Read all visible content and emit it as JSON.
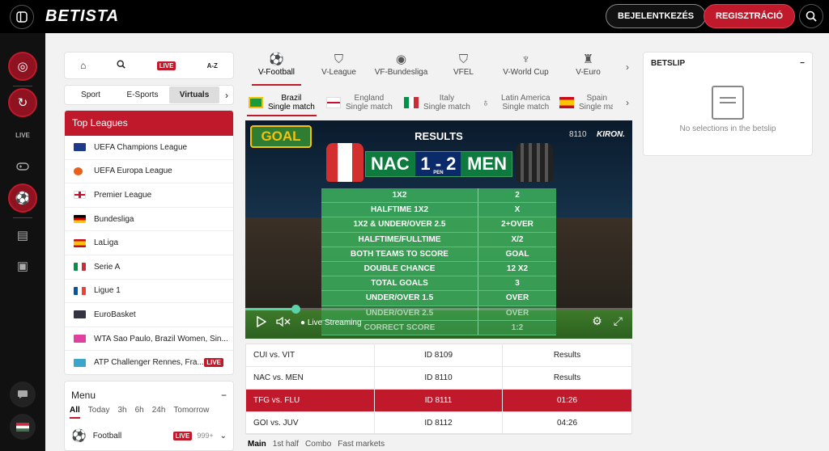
{
  "header": {
    "logo": "BETISTA",
    "login_label": "BEJELENTKEZÉS",
    "register_label": "REGISZTRÁCIÓ"
  },
  "rail": {
    "live_label": "LIVE"
  },
  "quick_tabs": {
    "live": "LIVE",
    "az": "A-Z"
  },
  "sport_tabs": [
    "Sport",
    "E-Sports",
    "Virtuals"
  ],
  "top_leagues": {
    "title": "Top Leagues",
    "items": [
      {
        "name": "UEFA Champions League",
        "live": false
      },
      {
        "name": "UEFA Europa League",
        "live": false
      },
      {
        "name": "Premier League",
        "live": false
      },
      {
        "name": "Bundesliga",
        "live": false
      },
      {
        "name": "LaLiga",
        "live": false
      },
      {
        "name": "Serie A",
        "live": false
      },
      {
        "name": "Ligue 1",
        "live": false
      },
      {
        "name": "EuroBasket",
        "live": false
      },
      {
        "name": "WTA Sao Paulo, Brazil Women, Sin...",
        "live": false
      },
      {
        "name": "ATP Challenger Rennes, Fra...",
        "live": true,
        "badge": "LIVE"
      }
    ]
  },
  "menu": {
    "title": "Menu",
    "filters": [
      "All",
      "Today",
      "3h",
      "6h",
      "24h",
      "Tomorrow"
    ],
    "sport": "Football",
    "live_badge": "LIVE",
    "count": "999+"
  },
  "virtual_tabs": [
    {
      "label": "V-Football",
      "icon": "soccer-ball-icon"
    },
    {
      "label": "V-League",
      "icon": "shield-icon"
    },
    {
      "label": "VF-Bundesliga",
      "icon": "ball-icon"
    },
    {
      "label": "VFEL",
      "icon": "shield-icon"
    },
    {
      "label": "V-World Cup",
      "icon": "trophy-icon"
    },
    {
      "label": "V-Euro",
      "icon": "trophy-icon"
    }
  ],
  "match_tabs": [
    {
      "line1": "Brazil",
      "line2": "Single match"
    },
    {
      "line1": "England",
      "line2": "Single match"
    },
    {
      "line1": "Italy",
      "line2": "Single match"
    },
    {
      "line1": "Latin America",
      "line2": "Single match"
    },
    {
      "line1": "Spain",
      "line2": "Single ma"
    }
  ],
  "video": {
    "badge": "GOAL",
    "title": "RESULTS",
    "event_id": "8110",
    "brand": "KIRON.",
    "home": "NAC",
    "home_score": "1",
    "away_score": "2",
    "away": "MEN",
    "pen": "PEN",
    "dash": "-",
    "results": [
      {
        "market": "1X2",
        "value": "2"
      },
      {
        "market": "HALFTIME 1X2",
        "value": "X"
      },
      {
        "market": "1X2 & UNDER/OVER 2.5",
        "value": "2+OVER"
      },
      {
        "market": "HALFTIME/FULLTIME",
        "value": "X/2"
      },
      {
        "market": "BOTH TEAMS TO SCORE",
        "value": "GOAL"
      },
      {
        "market": "DOUBLE CHANCE",
        "value": "12  X2"
      },
      {
        "market": "TOTAL GOALS",
        "value": "3"
      },
      {
        "market": "UNDER/OVER 1.5",
        "value": "OVER"
      },
      {
        "market": "UNDER/OVER 2.5",
        "value": "OVER"
      },
      {
        "market": "CORRECT SCORE",
        "value": "1:2"
      }
    ],
    "progress_fraction": 0.13,
    "live_streaming": "Live Streaming"
  },
  "matches": [
    {
      "teams": "CUI vs. VIT",
      "id": "ID 8109",
      "status": "Results",
      "active": false
    },
    {
      "teams": "NAC vs. MEN",
      "id": "ID 8110",
      "status": "Results",
      "active": false
    },
    {
      "teams": "TFG vs. FLU",
      "id": "ID 8111",
      "status": "01:26",
      "active": true
    },
    {
      "teams": "GOI vs. JUV",
      "id": "ID 8112",
      "status": "04:26",
      "active": false
    }
  ],
  "bottom_tabs": [
    "Main",
    "1st half",
    "Combo",
    "Fast markets"
  ],
  "betslip": {
    "title": "BETSLIP",
    "empty_text": "No selections in the betslip"
  },
  "colors": {
    "brand_red": "#c0192b",
    "results_green": "#3aaa5a"
  }
}
